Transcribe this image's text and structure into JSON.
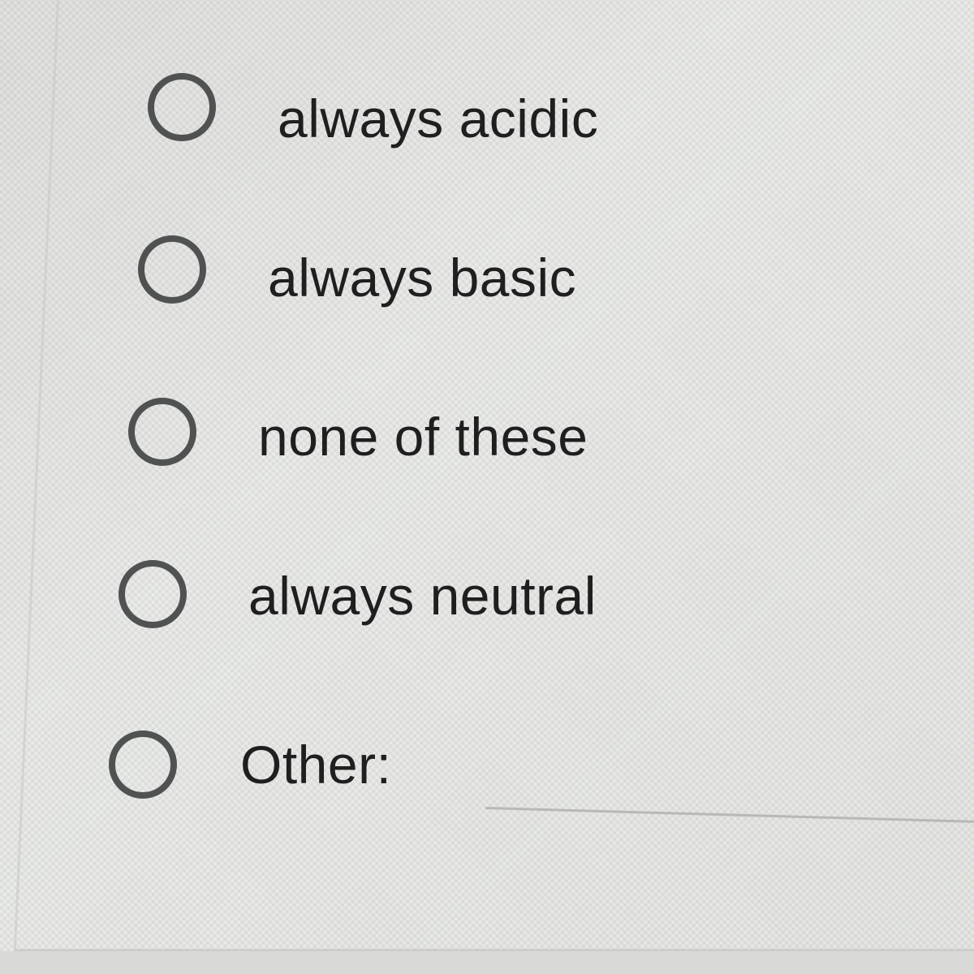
{
  "question": {
    "options": [
      {
        "label": "always acidic",
        "selected": false
      },
      {
        "label": "always basic",
        "selected": false
      },
      {
        "label": "none of these",
        "selected": false
      },
      {
        "label": "always neutral",
        "selected": false
      },
      {
        "label": "Other:",
        "selected": false
      }
    ],
    "other_input": {
      "value": "",
      "placeholder": ""
    }
  },
  "colors": {
    "background": "#e7e8e6",
    "radio_border": "#505252",
    "text": "#1f1f1f",
    "input_underline": "#b8b9b7"
  }
}
